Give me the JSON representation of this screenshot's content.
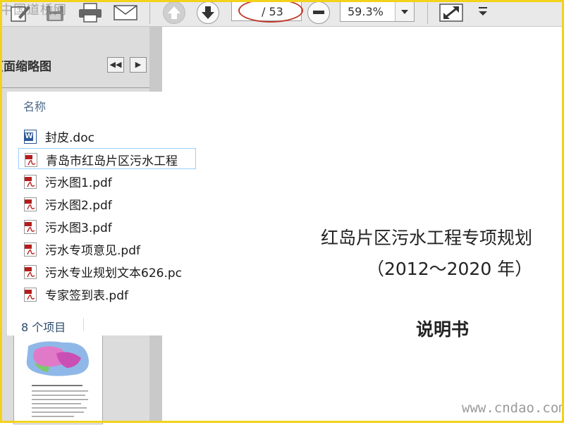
{
  "watermarks": {
    "top_left": "中国道桥网",
    "bottom_right": "www.cndao.com"
  },
  "toolbar": {
    "page_total": "/ 53",
    "zoom_value": "59.3%",
    "icons": [
      "edit-icon",
      "save-icon",
      "print-icon",
      "email-icon",
      "page-up-icon",
      "page-down-icon",
      "zoom-out-icon",
      "zoom-dropdown-icon",
      "fit-page-icon",
      "more-tools-icon"
    ]
  },
  "thumb_panel": {
    "title": "页面缩略图",
    "prev_label": "◀◀",
    "next_label": "▶"
  },
  "explorer": {
    "column_header": "名称",
    "files": [
      {
        "name": "封皮.doc",
        "type": "doc"
      },
      {
        "name": "青岛市红岛片区污水工程",
        "type": "pdf"
      },
      {
        "name": "污水图1.pdf",
        "type": "pdf"
      },
      {
        "name": "污水图2.pdf",
        "type": "pdf"
      },
      {
        "name": "污水图3.pdf",
        "type": "pdf"
      },
      {
        "name": "污水专项意见.pdf",
        "type": "pdf"
      },
      {
        "name": "污水专业规划文本626.pc",
        "type": "pdf"
      },
      {
        "name": "专家签到表.pdf",
        "type": "pdf"
      }
    ],
    "item_count": "8 个项目"
  },
  "document": {
    "title": "红岛片区污水工程专项规划",
    "years": "（2012～2020 年）",
    "subtitle": "说明书"
  },
  "colors": {
    "frame": "#f2d21b",
    "highlight_ellipse": "#c0392b",
    "selection_border": "#99d1ff"
  }
}
